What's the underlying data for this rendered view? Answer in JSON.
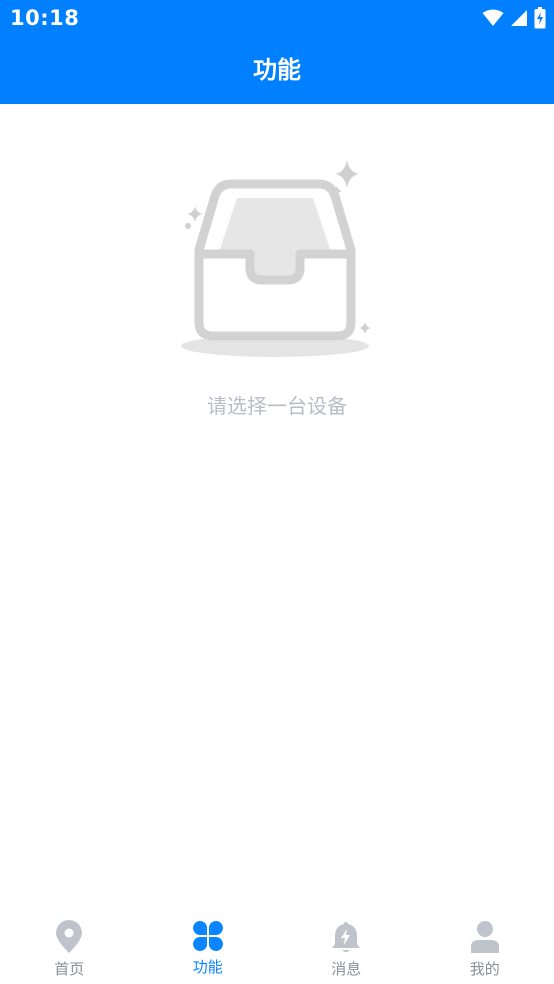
{
  "status_bar": {
    "time": "10:18",
    "icons": [
      "wifi-icon",
      "cellular-signal-icon",
      "battery-charging-icon"
    ]
  },
  "header": {
    "title": "功能"
  },
  "empty_state": {
    "icon": "empty-inbox-icon",
    "message": "请选择一台设备"
  },
  "tabbar": {
    "items": [
      {
        "label": "首页",
        "icon": "location-pin-icon",
        "active": false
      },
      {
        "label": "功能",
        "icon": "four-petal-grid-icon",
        "active": true
      },
      {
        "label": "消息",
        "icon": "bell-lightning-icon",
        "active": false
      },
      {
        "label": "我的",
        "icon": "user-icon",
        "active": false
      }
    ]
  },
  "colors": {
    "primary": "#0080ff",
    "tab_active": "#0a84ff",
    "tab_inactive": "#8a8f99",
    "icon_inactive": "#bfc4cc",
    "empty_text": "#b8bcc6"
  }
}
